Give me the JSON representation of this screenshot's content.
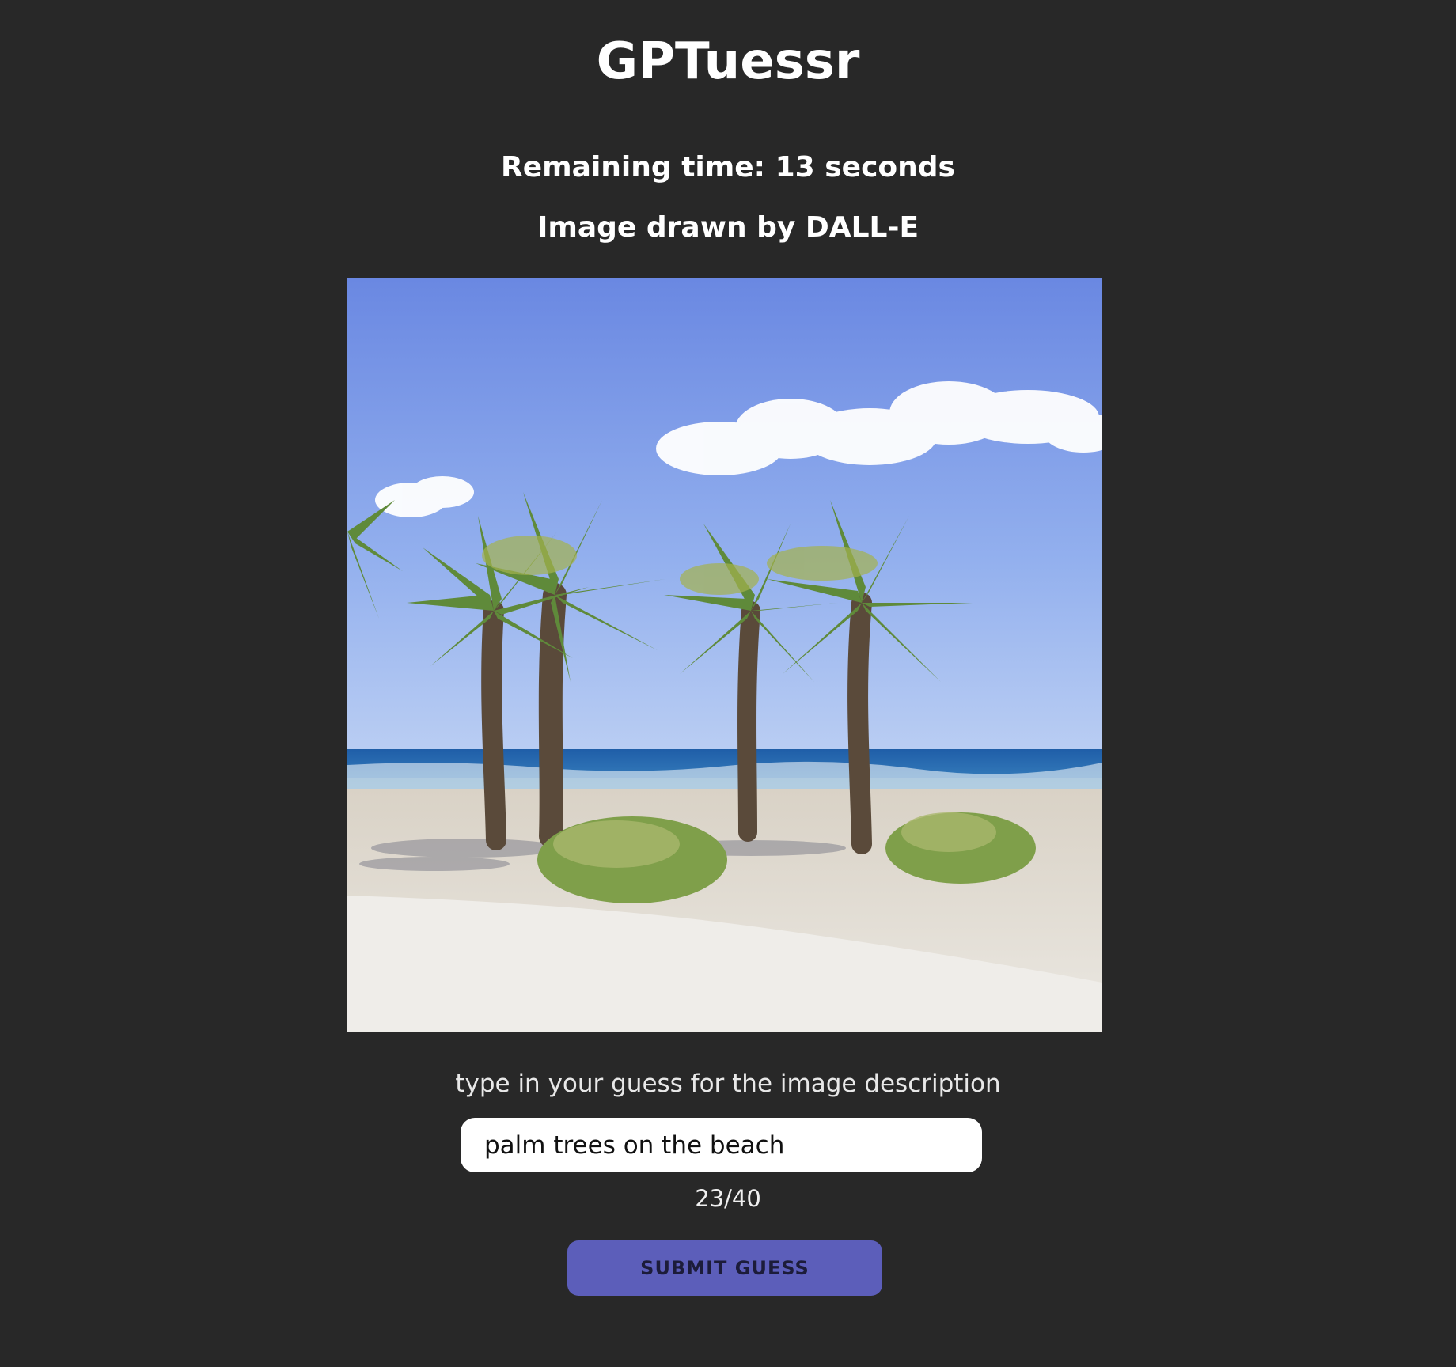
{
  "header": {
    "title": "GPTuessr"
  },
  "game": {
    "timer_text": "Remaining time: 13 seconds",
    "image_credit": "Image drawn by DALL-E"
  },
  "guess": {
    "prompt": "type in your guess for the image description",
    "value": "palm trees on the beach",
    "char_count": "23/40",
    "submit_label": "SUBMIT GUESS"
  },
  "colors": {
    "background": "#282828",
    "accent": "#5c5eba",
    "input_bg": "#ffffff"
  }
}
